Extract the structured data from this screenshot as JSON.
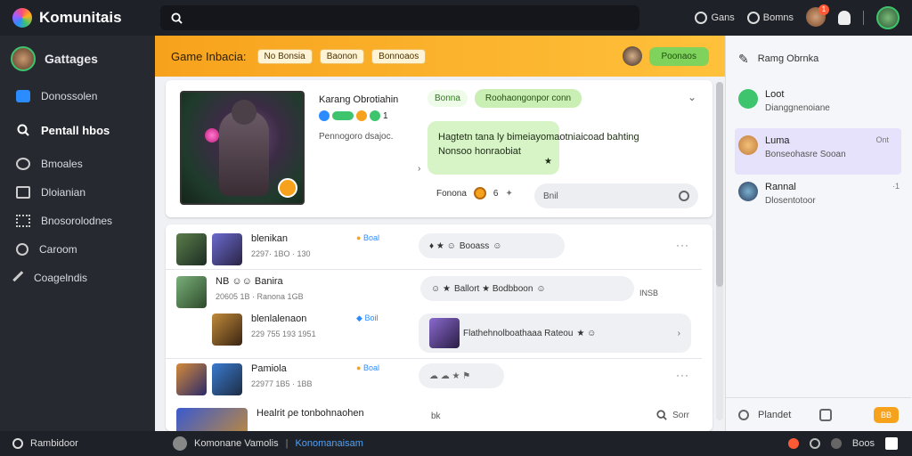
{
  "colors": {
    "accent": "#f7a21c",
    "green": "#7fd35d",
    "sidebar": "#262930",
    "topbar": "#1e2128"
  },
  "app": {
    "name": "Komunitais"
  },
  "search": {
    "icon": "search-icon"
  },
  "top_actions": {
    "games_label": "Gans",
    "home_label": "Bomns",
    "notification_count": "1"
  },
  "sidebar": {
    "user_name": "Gattages",
    "items": [
      {
        "label": "Donossolen",
        "icon": "chat-icon"
      },
      {
        "label": "Pentall hbos",
        "icon": "search-icon"
      },
      {
        "label": "Bmoales",
        "icon": "comment-icon"
      },
      {
        "label": "Dloianian",
        "icon": "square-icon"
      },
      {
        "label": "Bnosorolodnes",
        "icon": "grid-icon"
      },
      {
        "label": "Caroom",
        "icon": "clock-icon"
      },
      {
        "label": "Coagelndis",
        "icon": "pen-icon"
      }
    ]
  },
  "header": {
    "title": "Game Inbacia:",
    "chips": [
      "No Bonsia",
      "Baonon",
      "Bonnoaos"
    ],
    "button_label": "Poonaos"
  },
  "featured": {
    "title": "Karang Obrotiahin",
    "icon_count": "1",
    "subtitle": "Pennogoro dsajoc.",
    "tag1": "Bonna",
    "tag2": "Roohaongonpor conn",
    "message_line1": "Hagtetn tana ly bimeiayomaotniaicoad bahting",
    "message_line2": "Nonsoo honraobiat",
    "bottom_label": "Fonona",
    "bottom_count": "6",
    "input_label": "Bnil"
  },
  "feed": [
    {
      "name": "blenikan",
      "meta": "2297· 1BO · 130",
      "status": "Boal",
      "chat": "Booass"
    },
    {
      "name": "Banira",
      "prefix": "NB",
      "meta": "20605 1B · Ranona 1GB",
      "chat_text": "Ballort ★ Bodbboon",
      "chat_suffix": "INSB"
    },
    {
      "name": "blenlalenaon",
      "meta": "229 755 193 1951",
      "status": "Boil",
      "chat_text": "Flathehnolboathaaa Rateou"
    },
    {
      "name": "Pamiola",
      "meta": "22977 1B5 · 1BB",
      "status": "Boal"
    },
    {
      "name": "Healrit ρe tonbohnaohen",
      "chat": "bk",
      "search_label": "Sorr"
    }
  ],
  "right_panel": {
    "header": "Ramg Obrnka",
    "conversations": [
      {
        "name": "Loot",
        "sub": "Dianggnenoiane",
        "time": ""
      },
      {
        "name": "Luma",
        "sub": "Bonseohasre Sooan",
        "time": "Ont"
      },
      {
        "name": "Rannal",
        "sub": "Dlosentotoor",
        "time": "·1"
      }
    ],
    "footer_label": "Plandet",
    "footer_button": "BB"
  },
  "bottom_bar": {
    "left": "Rambidoor",
    "mid1": "Komonane Vamolis",
    "mid2": "Konomanaisam",
    "right": "Boos"
  }
}
